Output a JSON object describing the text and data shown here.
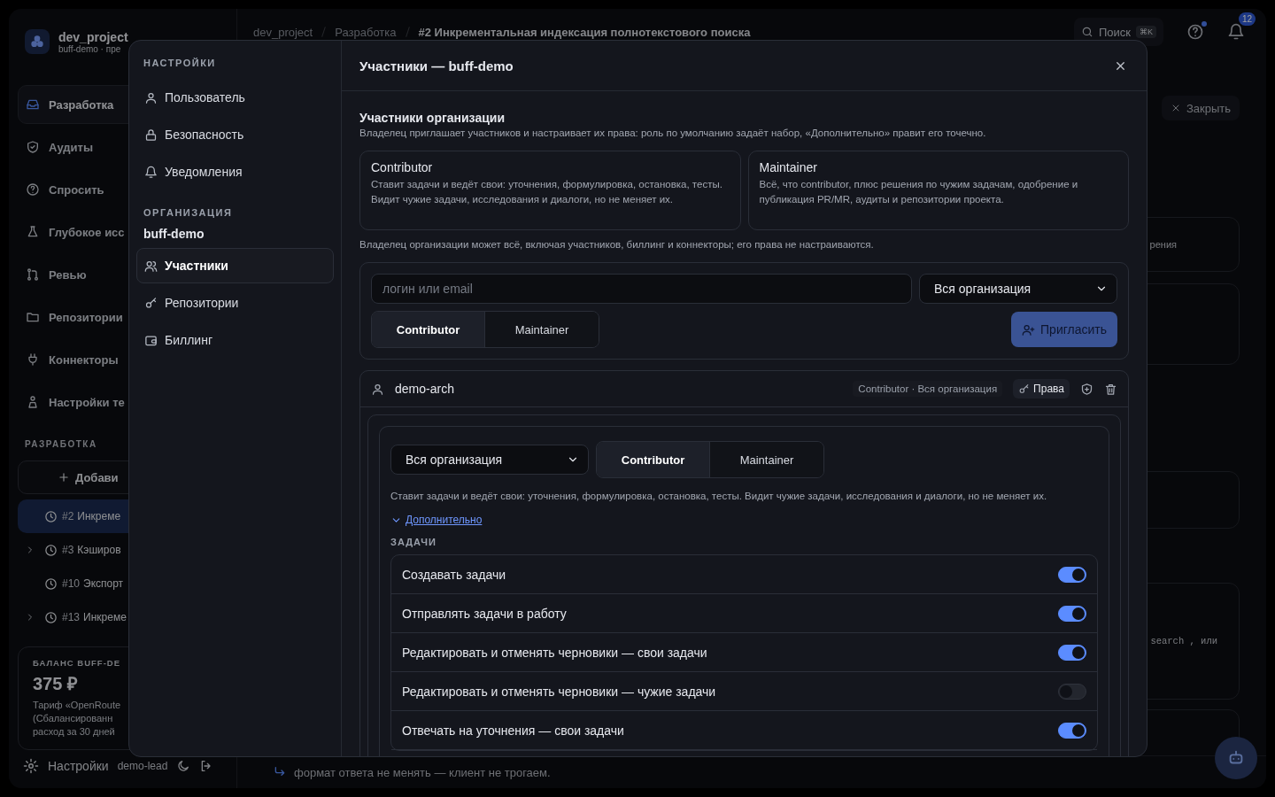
{
  "app": {
    "workspace": {
      "name": "dev_project",
      "subtitle": "buff-demo · пре"
    },
    "nav": [
      {
        "label": "Разработка",
        "selected": true
      },
      {
        "label": "Аудиты",
        "selected": false
      },
      {
        "label": "Спросить",
        "selected": false
      },
      {
        "label": "Глубокое исс",
        "selected": false
      },
      {
        "label": "Ревью",
        "selected": false
      },
      {
        "label": "Репозитории",
        "selected": false
      },
      {
        "label": "Коннекторы",
        "selected": false
      },
      {
        "label": "Настройки те",
        "selected": false
      }
    ],
    "section_title": "РАЗРАБОТКА",
    "add_button": "Добави",
    "tasks": [
      {
        "number": "#2",
        "title": "Инкреме",
        "selected": true,
        "expandable": false
      },
      {
        "number": "#3",
        "title": "Кэширов",
        "selected": false,
        "expandable": true
      },
      {
        "number": "#10",
        "title": "Экспорт",
        "selected": false,
        "expandable": false
      },
      {
        "number": "#13",
        "title": "Инкреме",
        "selected": false,
        "expandable": true
      }
    ],
    "balance": {
      "title": "БАЛАНС BUFF-DE",
      "amount": "375 ₽",
      "lines": [
        "Тариф «OpenRoute",
        "(Сбалансированн",
        "расход за 30 дней"
      ]
    },
    "footer": {
      "settings": "Настройки",
      "user": "demo-lead"
    },
    "breadcrumb": [
      "dev_project",
      "Разработка",
      "#2 Инкрементальная индексация полнотекстового поиска"
    ],
    "search": {
      "placeholder": "Поиск",
      "shortcut": "⌘K"
    },
    "notification_count": "12",
    "close_button": "Закрыть",
    "card_texts": [
      "рения",
      "search , или"
    ],
    "footer_note": "формат ответа не менять — клиент не трогаем."
  },
  "modal": {
    "nav": [
      {
        "title": "НАСТРОЙКИ",
        "items": [
          {
            "label": "Пользователь",
            "selected": false
          },
          {
            "label": "Безопасность",
            "selected": false
          },
          {
            "label": "Уведомления",
            "selected": false
          }
        ]
      },
      {
        "title": "ОРГАНИЗАЦИЯ",
        "org": "buff-demo",
        "items": [
          {
            "label": "Участники",
            "selected": true
          },
          {
            "label": "Репозитории",
            "selected": false
          },
          {
            "label": "Биллинг",
            "selected": false
          }
        ]
      }
    ],
    "title": "Участники — buff-demo",
    "section": {
      "title": "Участники организации",
      "description": "Владелец приглашает участников и настраивает их права: роль по умолчанию задаёт набор, «Дополнительно» правит его точечно."
    },
    "roles": [
      {
        "name": "Contributor",
        "description": "Ставит задачи и ведёт свои: уточнения, формулировка, остановка, тесты. Видит чужие задачи, исследования и диалоги, но не меняет их."
      },
      {
        "name": "Maintainer",
        "description": "Всё, что contributor, плюс решения по чужим задачам, одобрение и публикация PR/MR, аудиты и репозитории проекта."
      }
    ],
    "owner_note": "Владелец организации может всё, включая участников, биллинг и коннекторы; его права не настраиваются.",
    "invite": {
      "placeholder": "логин или email",
      "scope": "Вся организация",
      "roles": [
        {
          "label": "Contributor",
          "selected": true
        },
        {
          "label": "Maintainer",
          "selected": false
        }
      ],
      "button": "Пригласить"
    },
    "members": [
      {
        "login": "demo-arch",
        "summary": "Contributor · Вся организация",
        "rights_button": "Права",
        "expanded": true,
        "editor": {
          "scope": "Вся организация",
          "roles": [
            {
              "label": "Contributor",
              "selected": true
            },
            {
              "label": "Maintainer",
              "selected": false
            }
          ],
          "description": "Ставит задачи и ведёт свои: уточнения, формулировка, остановка, тесты. Видит чужие задачи, исследования и диалоги, но не меняет их.",
          "advanced": {
            "label": "Дополнительно",
            "expanded": true
          },
          "group": "ЗАДАЧИ",
          "permissions": [
            {
              "label": "Создавать задачи",
              "on": true
            },
            {
              "label": "Отправлять задачи в работу",
              "on": true
            },
            {
              "label": "Редактировать и отменять черновики — свои задачи",
              "on": true
            },
            {
              "label": "Редактировать и отменять черновики — чужие задачи",
              "on": false
            },
            {
              "label": "Отвечать на уточнения — свои задачи",
              "on": true
            }
          ]
        }
      }
    ]
  }
}
